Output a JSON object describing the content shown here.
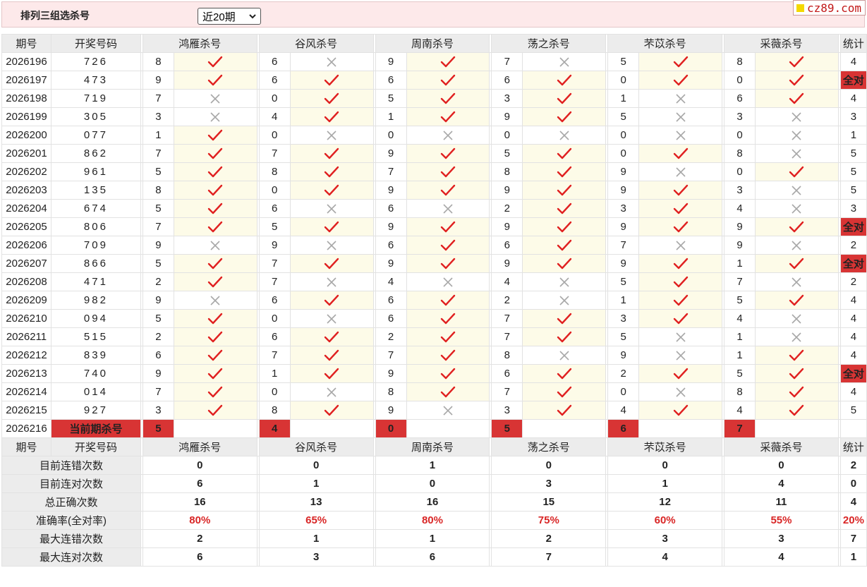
{
  "header": {
    "title": "排列三组选杀号",
    "period_select": "近20期",
    "logo": "cz89.com"
  },
  "columns": {
    "period": "期号",
    "draw": "开奖号码",
    "experts": [
      "鸿雁杀号",
      "谷风杀号",
      "周南杀号",
      "荡之杀号",
      "芣苡杀号",
      "采薇杀号"
    ],
    "stats": "统计"
  },
  "rows": [
    {
      "period": "2026196",
      "draw": "726",
      "kills": [
        "8",
        "6",
        "9",
        "7",
        "5",
        "8"
      ],
      "marks": [
        "ok",
        "x",
        "ok",
        "x",
        "ok",
        "ok"
      ],
      "stat": "4"
    },
    {
      "period": "2026197",
      "draw": "473",
      "kills": [
        "9",
        "6",
        "6",
        "6",
        "0",
        "0"
      ],
      "marks": [
        "ok",
        "ok",
        "ok",
        "ok",
        "ok",
        "ok"
      ],
      "stat": "全对"
    },
    {
      "period": "2026198",
      "draw": "719",
      "kills": [
        "7",
        "0",
        "5",
        "3",
        "1",
        "6"
      ],
      "marks": [
        "x",
        "ok",
        "ok",
        "ok",
        "x",
        "ok"
      ],
      "stat": "4"
    },
    {
      "period": "2026199",
      "draw": "305",
      "kills": [
        "3",
        "4",
        "1",
        "9",
        "5",
        "3"
      ],
      "marks": [
        "x",
        "ok",
        "ok",
        "ok",
        "x",
        "x"
      ],
      "stat": "3"
    },
    {
      "period": "2026200",
      "draw": "077",
      "kills": [
        "1",
        "0",
        "0",
        "0",
        "0",
        "0"
      ],
      "marks": [
        "ok",
        "x",
        "x",
        "x",
        "x",
        "x"
      ],
      "stat": "1"
    },
    {
      "period": "2026201",
      "draw": "862",
      "kills": [
        "7",
        "7",
        "9",
        "5",
        "0",
        "8"
      ],
      "marks": [
        "ok",
        "ok",
        "ok",
        "ok",
        "ok",
        "x"
      ],
      "stat": "5"
    },
    {
      "period": "2026202",
      "draw": "961",
      "kills": [
        "5",
        "8",
        "7",
        "8",
        "9",
        "0"
      ],
      "marks": [
        "ok",
        "ok",
        "ok",
        "ok",
        "x",
        "ok"
      ],
      "stat": "5"
    },
    {
      "period": "2026203",
      "draw": "135",
      "kills": [
        "8",
        "0",
        "9",
        "9",
        "9",
        "3"
      ],
      "marks": [
        "ok",
        "ok",
        "ok",
        "ok",
        "ok",
        "x"
      ],
      "stat": "5"
    },
    {
      "period": "2026204",
      "draw": "674",
      "kills": [
        "5",
        "6",
        "6",
        "2",
        "3",
        "4"
      ],
      "marks": [
        "ok",
        "x",
        "x",
        "ok",
        "ok",
        "x"
      ],
      "stat": "3"
    },
    {
      "period": "2026205",
      "draw": "806",
      "kills": [
        "7",
        "5",
        "9",
        "9",
        "9",
        "9"
      ],
      "marks": [
        "ok",
        "ok",
        "ok",
        "ok",
        "ok",
        "ok"
      ],
      "stat": "全对"
    },
    {
      "period": "2026206",
      "draw": "709",
      "kills": [
        "9",
        "9",
        "6",
        "6",
        "7",
        "9"
      ],
      "marks": [
        "x",
        "x",
        "ok",
        "ok",
        "x",
        "x"
      ],
      "stat": "2"
    },
    {
      "period": "2026207",
      "draw": "866",
      "kills": [
        "5",
        "7",
        "9",
        "9",
        "9",
        "1"
      ],
      "marks": [
        "ok",
        "ok",
        "ok",
        "ok",
        "ok",
        "ok"
      ],
      "stat": "全对"
    },
    {
      "period": "2026208",
      "draw": "471",
      "kills": [
        "2",
        "7",
        "4",
        "4",
        "5",
        "7"
      ],
      "marks": [
        "ok",
        "x",
        "x",
        "x",
        "ok",
        "x"
      ],
      "stat": "2"
    },
    {
      "period": "2026209",
      "draw": "982",
      "kills": [
        "9",
        "6",
        "6",
        "2",
        "1",
        "5"
      ],
      "marks": [
        "x",
        "ok",
        "ok",
        "x",
        "ok",
        "ok"
      ],
      "stat": "4"
    },
    {
      "period": "2026210",
      "draw": "094",
      "kills": [
        "5",
        "0",
        "6",
        "7",
        "3",
        "4"
      ],
      "marks": [
        "ok",
        "x",
        "ok",
        "ok",
        "ok",
        "x"
      ],
      "stat": "4"
    },
    {
      "period": "2026211",
      "draw": "515",
      "kills": [
        "2",
        "6",
        "2",
        "7",
        "5",
        "1"
      ],
      "marks": [
        "ok",
        "ok",
        "ok",
        "ok",
        "x",
        "x"
      ],
      "stat": "4"
    },
    {
      "period": "2026212",
      "draw": "839",
      "kills": [
        "6",
        "7",
        "7",
        "8",
        "9",
        "1"
      ],
      "marks": [
        "ok",
        "ok",
        "ok",
        "x",
        "x",
        "ok"
      ],
      "stat": "4"
    },
    {
      "period": "2026213",
      "draw": "740",
      "kills": [
        "9",
        "1",
        "9",
        "6",
        "2",
        "5"
      ],
      "marks": [
        "ok",
        "ok",
        "ok",
        "ok",
        "ok",
        "ok"
      ],
      "stat": "全对"
    },
    {
      "period": "2026214",
      "draw": "014",
      "kills": [
        "7",
        "0",
        "8",
        "7",
        "0",
        "8"
      ],
      "marks": [
        "ok",
        "x",
        "ok",
        "ok",
        "x",
        "ok"
      ],
      "stat": "4"
    },
    {
      "period": "2026215",
      "draw": "927",
      "kills": [
        "3",
        "8",
        "9",
        "3",
        "4",
        "4"
      ],
      "marks": [
        "ok",
        "ok",
        "x",
        "ok",
        "ok",
        "ok"
      ],
      "stat": "5"
    }
  ],
  "current": {
    "period": "2026216",
    "label": "当前期杀号",
    "kills": [
      "5",
      "4",
      "0",
      "5",
      "6",
      "7"
    ]
  },
  "summary": [
    {
      "label": "目前连错次数",
      "values": [
        "0",
        "0",
        "1",
        "0",
        "0",
        "0"
      ],
      "stat": "2",
      "color": "blue"
    },
    {
      "label": "目前连对次数",
      "values": [
        "6",
        "1",
        "0",
        "3",
        "1",
        "4"
      ],
      "stat": "0",
      "color": "blue"
    },
    {
      "label": "总正确次数",
      "values": [
        "16",
        "13",
        "16",
        "15",
        "12",
        "11"
      ],
      "stat": "4",
      "color": "blue"
    },
    {
      "label": "准确率(全对率)",
      "values": [
        "80%",
        "65%",
        "80%",
        "75%",
        "60%",
        "55%"
      ],
      "stat": "20%",
      "color": "red"
    },
    {
      "label": "最大连错次数",
      "values": [
        "2",
        "1",
        "1",
        "2",
        "3",
        "3"
      ],
      "stat": "7",
      "color": "blue"
    },
    {
      "label": "最大连对次数",
      "values": [
        "6",
        "3",
        "6",
        "7",
        "4",
        "4"
      ],
      "stat": "1",
      "color": "blue"
    }
  ],
  "colors": {
    "correct": "#e02020",
    "wrong": "#a8a8a8",
    "highlight": "#d83434",
    "stat_blue": "#1a37c9"
  }
}
